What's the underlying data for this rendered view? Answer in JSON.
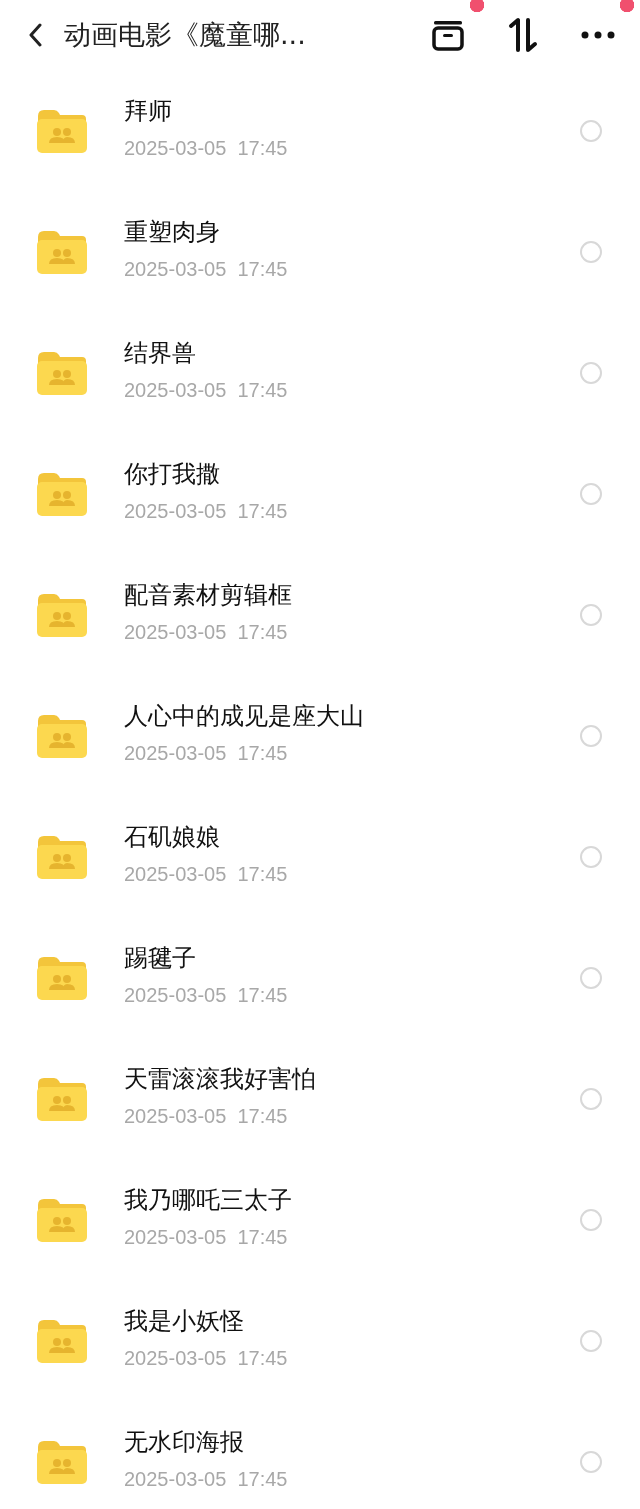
{
  "header": {
    "title": "动画电影《魔童哪...",
    "actions": [
      {
        "kind": "archive",
        "dot": true
      },
      {
        "kind": "sort",
        "dot": false
      },
      {
        "kind": "more",
        "dot": true
      }
    ]
  },
  "folders": [
    {
      "name": "拜师",
      "date": "2025-03-05  17:45",
      "selected": false
    },
    {
      "name": "重塑肉身",
      "date": "2025-03-05  17:45",
      "selected": false
    },
    {
      "name": "结界兽",
      "date": "2025-03-05  17:45",
      "selected": false
    },
    {
      "name": "你打我撒",
      "date": "2025-03-05  17:45",
      "selected": false
    },
    {
      "name": "配音素材剪辑框",
      "date": "2025-03-05  17:45",
      "selected": false
    },
    {
      "name": "人心中的成见是座大山",
      "date": "2025-03-05  17:45",
      "selected": false
    },
    {
      "name": "石矶娘娘",
      "date": "2025-03-05  17:45",
      "selected": false
    },
    {
      "name": "踢毽子",
      "date": "2025-03-05  17:45",
      "selected": false
    },
    {
      "name": "天雷滚滚我好害怕",
      "date": "2025-03-05  17:45",
      "selected": false
    },
    {
      "name": "我乃哪吒三太子",
      "date": "2025-03-05  17:45",
      "selected": false
    },
    {
      "name": "我是小妖怪",
      "date": "2025-03-05  17:45",
      "selected": false
    },
    {
      "name": "无水印海报",
      "date": "2025-03-05  17:45",
      "selected": false
    }
  ]
}
